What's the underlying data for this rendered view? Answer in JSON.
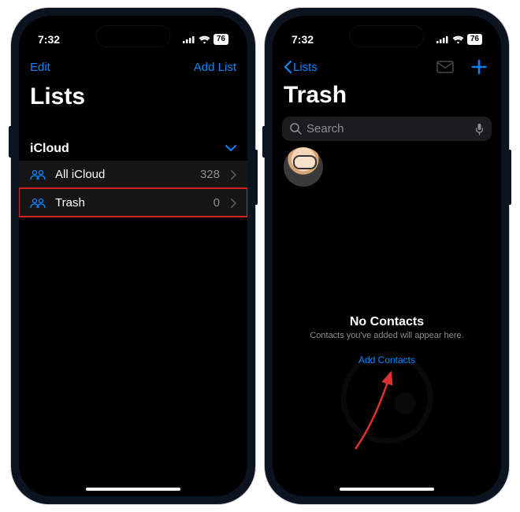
{
  "status": {
    "time": "7:32",
    "battery": "76"
  },
  "left": {
    "nav": {
      "edit": "Edit",
      "addList": "Add List"
    },
    "title": "Lists",
    "section": "iCloud",
    "rows": [
      {
        "label": "All iCloud",
        "count": "328"
      },
      {
        "label": "Trash",
        "count": "0"
      }
    ]
  },
  "right": {
    "back": "Lists",
    "title": "Trash",
    "searchPlaceholder": "Search",
    "empty": {
      "title": "No Contacts",
      "sub": "Contacts you've added will appear here.",
      "link": "Add Contacts"
    }
  }
}
